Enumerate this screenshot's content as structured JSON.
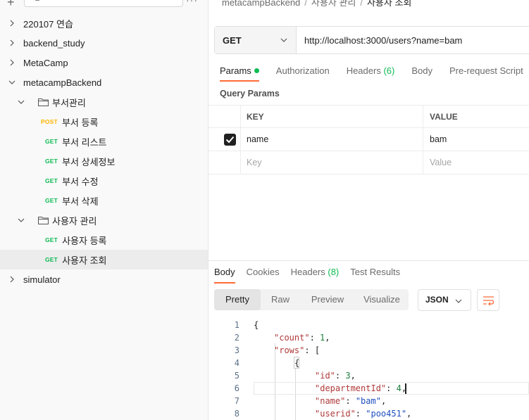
{
  "sidebar": {
    "items": [
      {
        "label": "220107 연습",
        "type": "collection",
        "expanded": false
      },
      {
        "label": "backend_study",
        "type": "collection",
        "expanded": false
      },
      {
        "label": "MetaCamp",
        "type": "collection",
        "expanded": false
      },
      {
        "label": "metacampBackend",
        "type": "collection",
        "expanded": true
      },
      {
        "label": "부서관리",
        "type": "folder",
        "expanded": true
      },
      {
        "label": "부서 등록",
        "type": "request",
        "method": "POST"
      },
      {
        "label": "부서 리스트",
        "type": "request",
        "method": "GET"
      },
      {
        "label": "부서 상세정보",
        "type": "request",
        "method": "GET"
      },
      {
        "label": "부서 수정",
        "type": "request",
        "method": "GET"
      },
      {
        "label": "부서 삭제",
        "type": "request",
        "method": "GET"
      },
      {
        "label": "사용자 관리",
        "type": "folder",
        "expanded": true
      },
      {
        "label": "사용자 등록",
        "type": "request",
        "method": "GET"
      },
      {
        "label": "사용자 조회",
        "type": "request",
        "method": "GET",
        "selected": true
      },
      {
        "label": "simulator",
        "type": "collection",
        "expanded": false
      }
    ]
  },
  "breadcrumb": {
    "parts": [
      "metacampBackend",
      "사용자 관리",
      "사용자 조회"
    ],
    "sep": "/"
  },
  "request": {
    "method": "GET",
    "url": "http://localhost:3000/users?name=bam"
  },
  "request_tabs": {
    "params": "Params",
    "authorization": "Authorization",
    "headers": "Headers",
    "headers_count": "(6)",
    "body": "Body",
    "prerequest": "Pre-request Script"
  },
  "query_params": {
    "label": "Query Params",
    "header_key": "KEY",
    "header_value": "VALUE",
    "rows": [
      {
        "key": "name",
        "value": "bam",
        "checked": true
      }
    ],
    "placeholder_key": "Key",
    "placeholder_value": "Value"
  },
  "response_tabs": {
    "body": "Body",
    "cookies": "Cookies",
    "headers": "Headers",
    "headers_count": "(8)",
    "test_results": "Test Results"
  },
  "view_modes": [
    "Pretty",
    "Raw",
    "Preview",
    "Visualize"
  ],
  "active_view": "Pretty",
  "format": "JSON",
  "code": {
    "line_numbers": [
      "1",
      "2",
      "3",
      "4",
      "5",
      "6",
      "7",
      "8"
    ],
    "brace_open": "{",
    "count_key": "\"count\"",
    "count_val": "1",
    "rows_key": "\"rows\"",
    "rows_open": "[",
    "obj_open": "{",
    "id_key": "\"id\"",
    "id_val": "3",
    "dept_key": "\"departmentId\"",
    "dept_val": "4",
    "name_key": "\"name\"",
    "name_val": "\"bam\"",
    "userid_key": "\"userid\"",
    "userid_val": "\"poo451\""
  },
  "colors": {
    "accent": "#ff6c37",
    "get": "#0cbb52",
    "post": "#ffb400"
  }
}
